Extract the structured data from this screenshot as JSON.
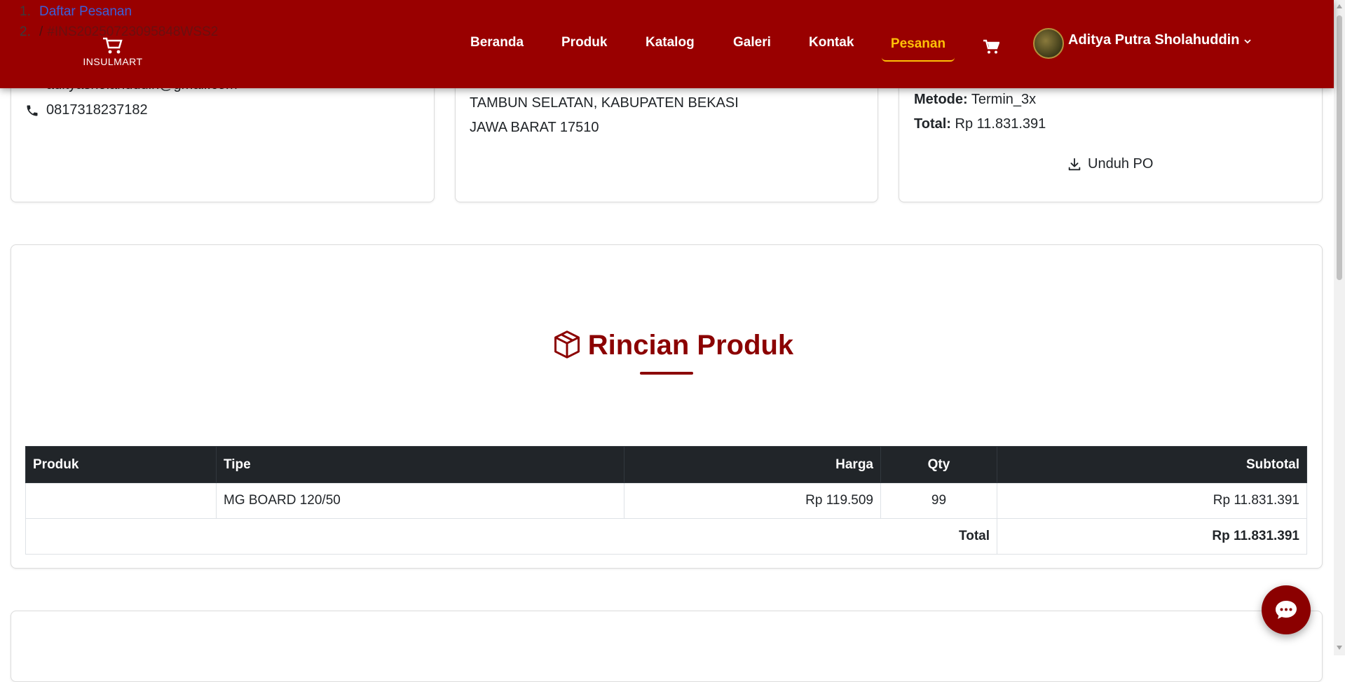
{
  "breadcrumb": {
    "items": [
      {
        "num": "1.",
        "label": "Daftar Pesanan"
      },
      {
        "num": "2.",
        "sep": "/",
        "label": "#INS20250723095848WSS2"
      }
    ]
  },
  "navbar": {
    "brand": "INSULMART",
    "links": [
      "Beranda",
      "Produk",
      "Katalog",
      "Galeri",
      "Kontak"
    ],
    "active": "Pesanan",
    "user_name": "Aditya Putra Sholahuddin",
    "cart_icon": "cart-icon",
    "caret_icon": "chevron-down-icon"
  },
  "customer": {
    "email": "adityasholahuddin@gmail.com",
    "phone": "0817318237182"
  },
  "address": {
    "line1": "TAMBUN SELATAN, KABUPATEN BEKASI",
    "line2": "JAWA BARAT 17510"
  },
  "payment": {
    "method_label": "Metode:",
    "method": "Termin_3x",
    "total_label": "Total:",
    "total": "Rp 11.831.391",
    "download_label": "Unduh PO"
  },
  "products": {
    "title": "Rincian Produk",
    "headers": [
      "Produk",
      "Tipe",
      "Harga",
      "Qty",
      "Subtotal"
    ],
    "rows": [
      {
        "produk": "",
        "tipe": "MG BOARD 120/50",
        "harga": "Rp 119.509",
        "qty": "99",
        "subtotal": "Rp 11.831.391"
      }
    ],
    "total_label": "Total",
    "total_value": "Rp 11.831.391"
  },
  "colors": {
    "navbar": "#990000",
    "accent": "#8b0000",
    "active_link": "#ffc107",
    "table_header": "#212529"
  }
}
